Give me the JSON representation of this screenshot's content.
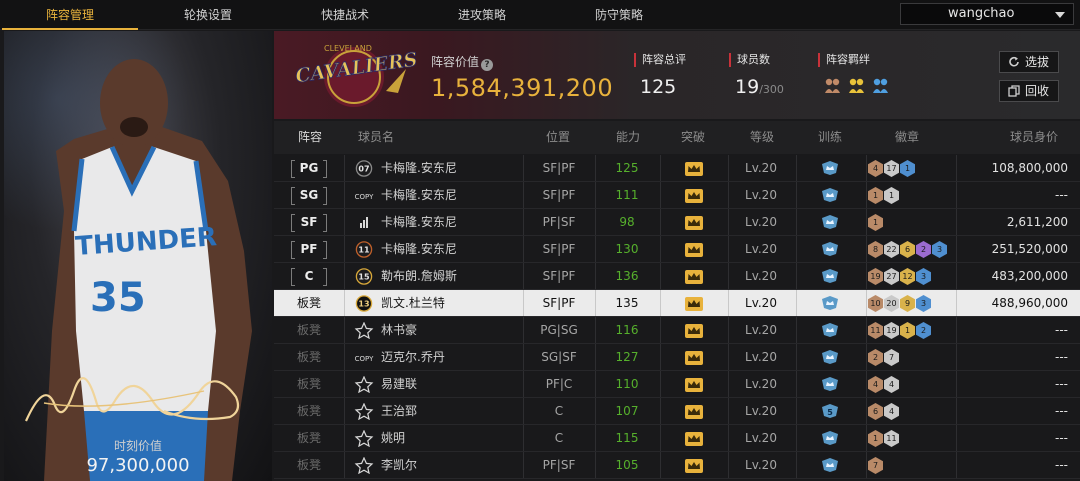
{
  "nav": {
    "tabs": [
      "阵容管理",
      "轮换设置",
      "快捷战术",
      "进攻策略",
      "防守策略"
    ],
    "active_tab": 0,
    "user": "wangchao"
  },
  "player_card": {
    "jersey_number": "35",
    "jersey_team": "THUNDER",
    "label": "时刻价值",
    "value": "97,300,000"
  },
  "team": {
    "logo_text": "CAVALIERS",
    "logo_subtext": "CLEVELAND",
    "value_label": "阵容价值",
    "value": "1,584,391,200",
    "rating_label": "阵容总评",
    "rating": "125",
    "count_label": "球员数",
    "count": "19",
    "count_max": "/300",
    "bonds_label": "阵容羁绊",
    "select_button": "选拔",
    "recycle_button": "回收"
  },
  "table": {
    "headers": [
      "阵容",
      "球员名",
      "位置",
      "能力",
      "突破",
      "等级",
      "训练",
      "徽章",
      "球员身价"
    ],
    "rows": [
      {
        "slot": "PG",
        "jersey": "07",
        "name": "卡梅隆.安东尼",
        "pos": "SF|PF",
        "ability": "125",
        "level": "Lv.20",
        "badges": [
          {
            "t": "br",
            "v": "4"
          },
          {
            "t": "sv",
            "v": "17"
          },
          {
            "t": "bl",
            "v": "1"
          }
        ],
        "value": "108,800,000",
        "selected": false
      },
      {
        "slot": "SG",
        "jersey": "COPY",
        "name": "卡梅隆.安东尼",
        "pos": "SF|PF",
        "ability": "111",
        "level": "Lv.20",
        "badges": [
          {
            "t": "br",
            "v": "1"
          },
          {
            "t": "sv",
            "v": "1"
          }
        ],
        "value": "---",
        "selected": false
      },
      {
        "slot": "SF",
        "jersey": "bars",
        "name": "卡梅隆.安东尼",
        "pos": "PF|SF",
        "ability": "98",
        "level": "Lv.20",
        "badges": [
          {
            "t": "br",
            "v": "1"
          }
        ],
        "value": "2,611,200",
        "selected": false
      },
      {
        "slot": "PF",
        "jersey": "11",
        "name": "卡梅隆.安东尼",
        "pos": "SF|PF",
        "ability": "130",
        "level": "Lv.20",
        "badges": [
          {
            "t": "br",
            "v": "8"
          },
          {
            "t": "sv",
            "v": "22"
          },
          {
            "t": "gd",
            "v": "6"
          },
          {
            "t": "pp",
            "v": "2"
          },
          {
            "t": "bl",
            "v": "3"
          }
        ],
        "value": "251,520,000",
        "selected": false
      },
      {
        "slot": "C",
        "jersey": "15",
        "name": "勒布朗.詹姆斯",
        "pos": "SF|PF",
        "ability": "136",
        "level": "Lv.20",
        "badges": [
          {
            "t": "br",
            "v": "19"
          },
          {
            "t": "sv",
            "v": "27"
          },
          {
            "t": "gd",
            "v": "12"
          },
          {
            "t": "bl",
            "v": "3"
          }
        ],
        "value": "483,200,000",
        "selected": false
      },
      {
        "slot": "板凳",
        "jersey": "13",
        "name": "凯文.杜兰特",
        "pos": "SF|PF",
        "ability": "135",
        "level": "Lv.20",
        "badges": [
          {
            "t": "br",
            "v": "10"
          },
          {
            "t": "sv",
            "v": "20"
          },
          {
            "t": "gd",
            "v": "9"
          },
          {
            "t": "bl",
            "v": "3"
          }
        ],
        "value": "488,960,000",
        "selected": true
      },
      {
        "slot": "板凳",
        "jersey": "star",
        "name": "林书豪",
        "pos": "PG|SG",
        "ability": "116",
        "level": "Lv.20",
        "badges": [
          {
            "t": "br",
            "v": "11"
          },
          {
            "t": "sv",
            "v": "19"
          },
          {
            "t": "gd",
            "v": "1"
          },
          {
            "t": "bl",
            "v": "2"
          }
        ],
        "value": "---",
        "selected": false
      },
      {
        "slot": "板凳",
        "jersey": "COPY",
        "name": "迈克尔.乔丹",
        "pos": "SG|SF",
        "ability": "127",
        "level": "Lv.20",
        "badges": [
          {
            "t": "br",
            "v": "2"
          },
          {
            "t": "sv",
            "v": "7"
          }
        ],
        "value": "---",
        "selected": false
      },
      {
        "slot": "板凳",
        "jersey": "star",
        "name": "易建联",
        "pos": "PF|C",
        "ability": "110",
        "level": "Lv.20",
        "badges": [
          {
            "t": "br",
            "v": "4"
          },
          {
            "t": "sv",
            "v": "4"
          }
        ],
        "value": "---",
        "selected": false
      },
      {
        "slot": "板凳",
        "jersey": "star",
        "name": "王治郅",
        "pos": "C",
        "ability": "107",
        "level": "Lv.20",
        "training": "5",
        "badges": [
          {
            "t": "br",
            "v": "6"
          },
          {
            "t": "sv",
            "v": "4"
          }
        ],
        "value": "---",
        "selected": false
      },
      {
        "slot": "板凳",
        "jersey": "star",
        "name": "姚明",
        "pos": "C",
        "ability": "115",
        "level": "Lv.20",
        "badges": [
          {
            "t": "br",
            "v": "1"
          },
          {
            "t": "sv",
            "v": "11"
          }
        ],
        "value": "---",
        "selected": false
      },
      {
        "slot": "板凳",
        "jersey": "star",
        "name": "李凯尔",
        "pos": "PF|SF",
        "ability": "105",
        "level": "Lv.20",
        "badges": [
          {
            "t": "br",
            "v": "7"
          }
        ],
        "value": "---",
        "selected": false
      }
    ]
  }
}
